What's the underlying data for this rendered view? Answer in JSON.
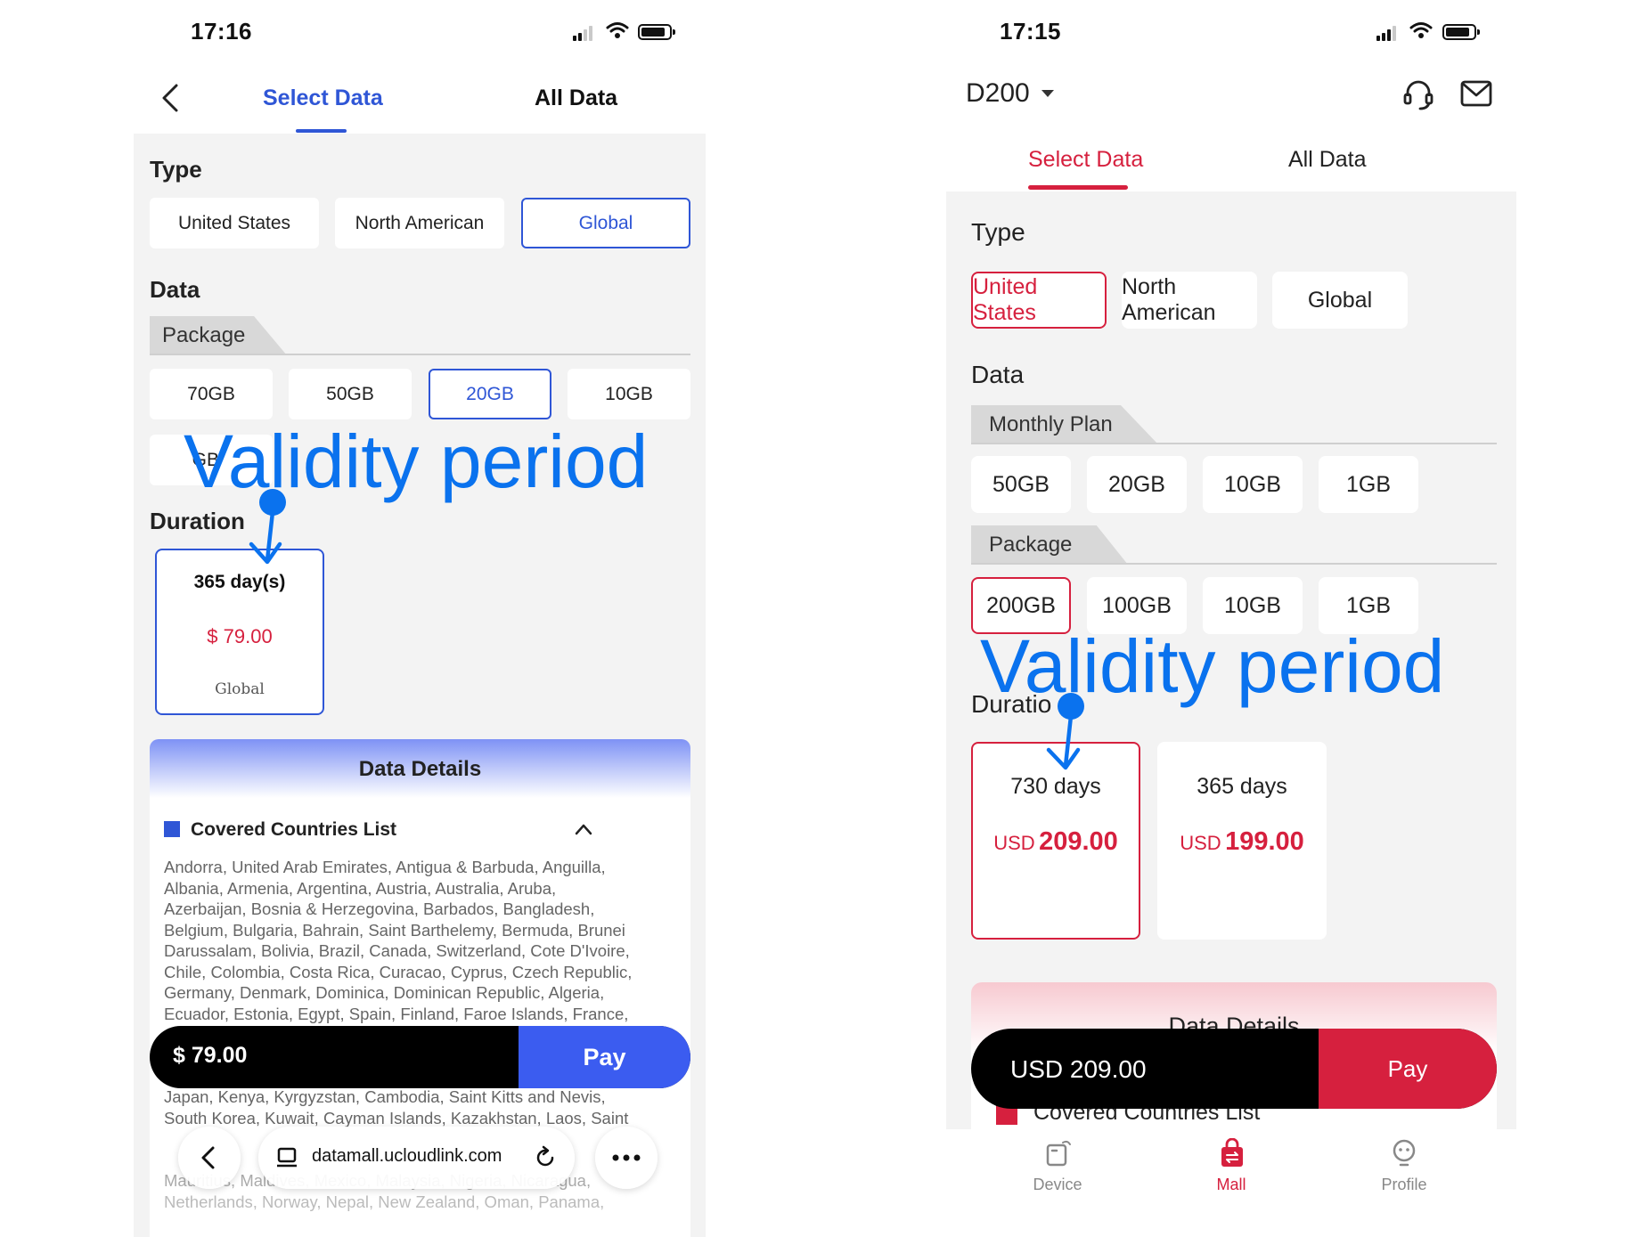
{
  "left": {
    "status": {
      "time": "17:16"
    },
    "tabs": {
      "select": "Select Data",
      "all": "All Data"
    },
    "type_heading": "Type",
    "types": [
      "United States",
      "North American",
      "Global"
    ],
    "data_heading": "Data",
    "package_tab": "Package",
    "packages": [
      "70GB",
      "50GB",
      "20GB",
      "10GB"
    ],
    "package_partial": "GB",
    "duration_heading": "Duration",
    "duration_card": {
      "days": "365 day(s)",
      "price": "$ 79.00",
      "region": "Global"
    },
    "details_title": "Data Details",
    "covered_title": "Covered Countries List",
    "countries_lines": [
      "Andorra, United Arab Emirates, Antigua & Barbuda, Anguilla,",
      "Albania, Armenia, Argentina, Austria, Australia, Aruba,",
      "Azerbaijan, Bosnia & Herzegovina, Barbados, Bangladesh,",
      "Belgium, Bulgaria, Bahrain, Saint Barthelemy, Bermuda, Brunei",
      "Darussalam, Bolivia, Brazil, Canada, Switzerland, Cote D'Ivoire,",
      "Chile, Colombia, Costa Rica, Curacao, Cyprus, Czech Republic,",
      "Germany, Denmark, Dominica, Dominican Republic, Algeria,",
      "Ecuador, Estonia, Egypt, Spain, Finland, Faroe Islands, France,"
    ],
    "countries_lines_lower": [
      "Japan, Kenya, Kyrgyzstan, Cambodia, Saint Kitts and Nevis,",
      "South Korea, Kuwait, Cayman Islands, Kazakhstan, Laos, Saint",
      "Mauritius, Maldives, Mexico, Malaysia, Nigeria, Nicaragua,",
      "Netherlands, Norway, Nepal, New Zealand, Oman, Panama,"
    ],
    "pay_total": "$ 79.00",
    "pay_label": "Pay",
    "browser_url": "datamall.ucloudlink.com",
    "overlay_text": "Validity period"
  },
  "right": {
    "status": {
      "time": "17:15"
    },
    "device_name": "D200",
    "tabs": {
      "select": "Select Data",
      "all": "All Data"
    },
    "type_heading": "Type",
    "types": [
      "United States",
      "North American",
      "Global"
    ],
    "data_heading": "Data",
    "monthly_tab": "Monthly Plan",
    "monthly": [
      "50GB",
      "20GB",
      "10GB",
      "1GB"
    ],
    "package_tab": "Package",
    "packages": [
      "200GB",
      "100GB",
      "10GB",
      "1GB"
    ],
    "duration_heading": "Duratio",
    "durations": [
      {
        "days": "730 days",
        "currency": "USD",
        "amount": "209.00"
      },
      {
        "days": "365 days",
        "currency": "USD",
        "amount": "199.00"
      }
    ],
    "details_title": "Data Details",
    "covered_title": "Covered Countries List",
    "pay_total": "USD 209.00",
    "pay_label": "Pay",
    "nav": [
      "Device",
      "Mall",
      "Profile"
    ],
    "overlay_text": "Validity period"
  },
  "colors": {
    "blue_accent": "#2f56d6",
    "red_accent": "#d6203e",
    "annotation_blue": "#0a72ee"
  }
}
